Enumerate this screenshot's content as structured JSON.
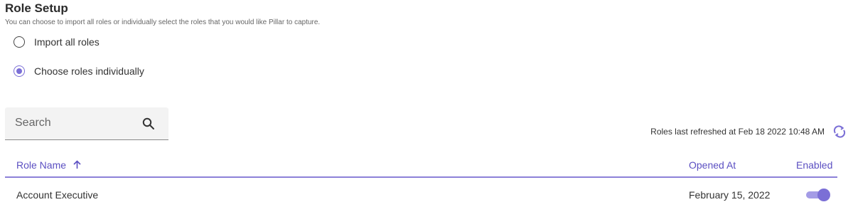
{
  "header": {
    "title": "Role Setup",
    "subtitle": "You can choose to import all roles or individually select the roles that you would like Pillar to capture."
  },
  "import_options": [
    {
      "label": "Import all roles",
      "selected": false
    },
    {
      "label": "Choose roles individually",
      "selected": true
    }
  ],
  "search": {
    "placeholder": "Search",
    "value": ""
  },
  "refresh": {
    "text": "Roles last refreshed at Feb 18 2022 10:48 AM"
  },
  "table": {
    "columns": {
      "role_name": "Role Name",
      "opened_at": "Opened At",
      "enabled": "Enabled"
    },
    "sort": {
      "column": "role_name",
      "direction": "ascending"
    },
    "rows": [
      {
        "role_name": "Account Executive",
        "opened_at": "February 15, 2022",
        "enabled": true
      }
    ]
  },
  "colors": {
    "accent": "#7b6fd6",
    "accent_light": "#a49ce6",
    "header_text": "#5b4fc2"
  }
}
